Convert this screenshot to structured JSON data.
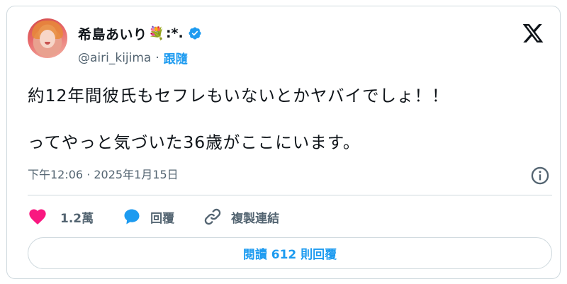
{
  "author": {
    "display_name": "希島あいり",
    "flower_emoji": "💐",
    "name_decoration": ":*.",
    "handle": "@airi_kijima",
    "separator": "·",
    "follow_label": "跟隨"
  },
  "tweet": {
    "lines": [
      "約12年間彼氏もセフレもいないとかヤバイでしょ！！",
      "ってやっと気づいた36歳がここにいます。"
    ],
    "timestamp": "下午12:06 · 2025年1月15日"
  },
  "actions": {
    "like_count": "1.2萬",
    "reply_label": "回覆",
    "copy_link_label": "複製連結"
  },
  "read_replies_label": "閱讀 612 則回覆",
  "colors": {
    "accent": "#1d9bf0",
    "like": "#f91880",
    "text": "#0f1419",
    "muted": "#536471",
    "border": "#cfd9de"
  },
  "icons": [
    "x-logo-icon",
    "verified-badge-icon",
    "info-icon",
    "heart-icon",
    "reply-bubble-icon",
    "link-icon"
  ]
}
